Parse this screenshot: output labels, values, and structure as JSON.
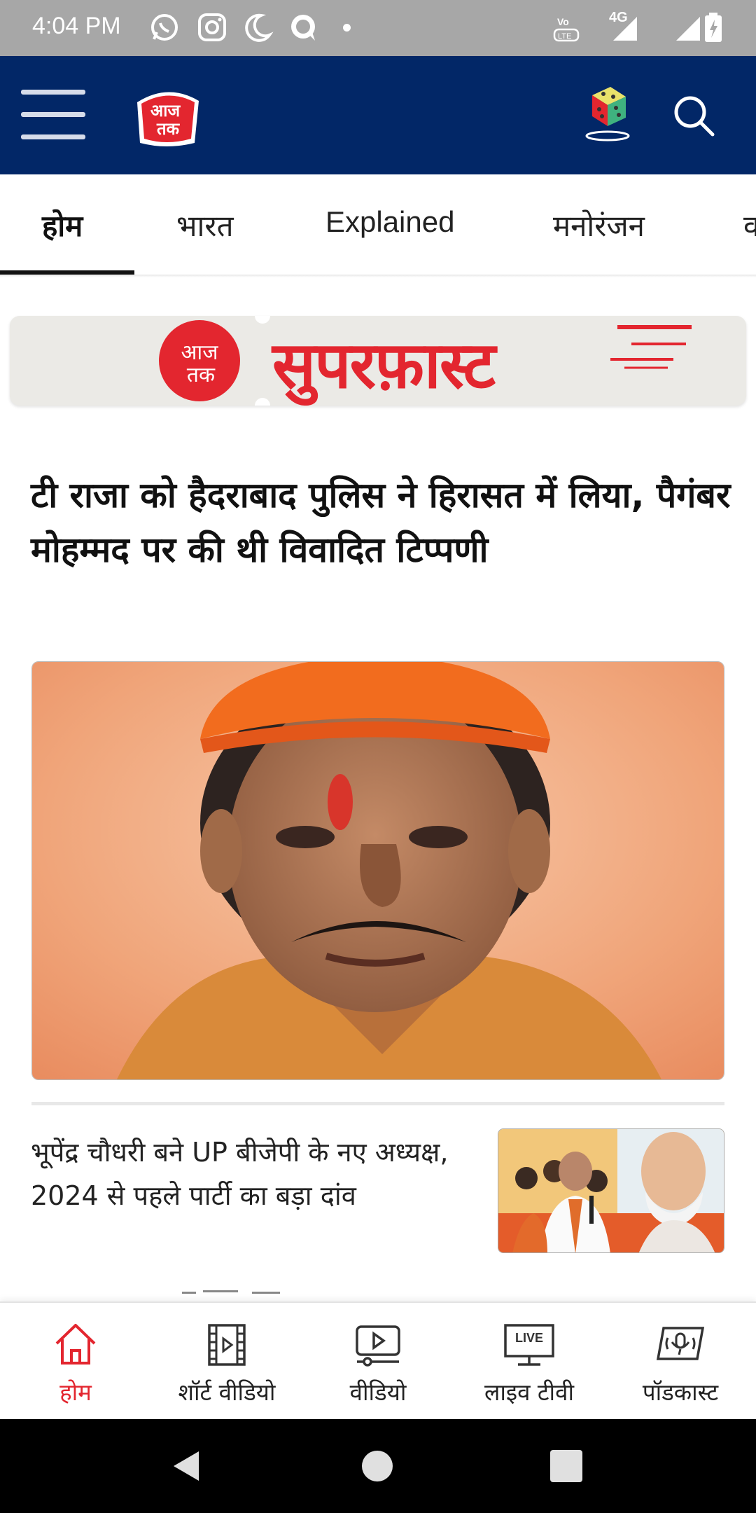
{
  "status_bar": {
    "time": "4:04 PM",
    "network_label": "4G",
    "icons": [
      "whatsapp-icon",
      "instagram-icon",
      "moon-icon",
      "chat-icon",
      "volte-icon",
      "signal-icon",
      "battery-icon"
    ]
  },
  "header": {
    "logo_text": "आज तक",
    "icons": [
      "menu-icon",
      "dice-icon",
      "search-icon"
    ]
  },
  "tabs": [
    {
      "label": "होम",
      "active": true
    },
    {
      "label": "भारत",
      "active": false
    },
    {
      "label": "Explained",
      "active": false
    },
    {
      "label": "मनोरंजन",
      "active": false
    },
    {
      "label": "व",
      "active": false
    }
  ],
  "banner": {
    "logo_text": "आज तक",
    "title": "सुपरफ़ास्ट"
  },
  "top_story": {
    "headline": "टी राजा को हैदराबाद पुलिस ने हिरासत में लिया, पैगंबर मोहम्मद पर की थी विवादित टिप्पणी"
  },
  "story_list": [
    {
      "title": "भूपेंद्र चौधरी बने UP बीजेपी के नए अध्यक्ष, 2024 से पहले पार्टी का बड़ा दांव"
    }
  ],
  "bottom_nav": [
    {
      "label": "होम",
      "icon": "home-icon",
      "active": true
    },
    {
      "label": "शॉर्ट वीडियो",
      "icon": "film-icon",
      "active": false
    },
    {
      "label": "वीडियो",
      "icon": "video-icon",
      "active": false
    },
    {
      "label": "लाइव टीवी",
      "icon": "live-tv-icon",
      "live_badge": "LIVE",
      "active": false
    },
    {
      "label": "पॉडकास्ट",
      "icon": "podcast-icon",
      "active": false
    }
  ],
  "colors": {
    "header_bg": "#022767",
    "accent_red": "#e3262f",
    "status_bar_bg": "#a7a7a7"
  }
}
